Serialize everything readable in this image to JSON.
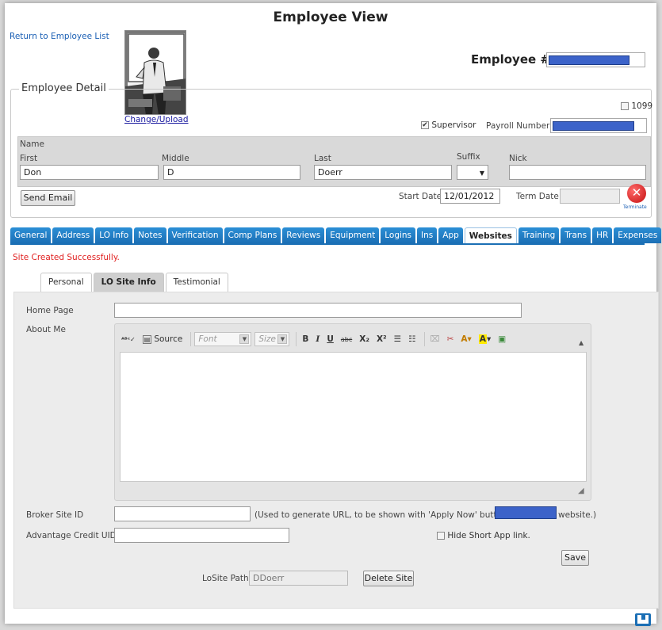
{
  "page_title": "Employee View",
  "return_link": "Return to Employee List",
  "photo": {
    "change_label": "Change/Upload"
  },
  "employee_number_label": "Employee #",
  "detail_legend": "Employee Detail",
  "flags": {
    "c1099": "1099",
    "supervisor": "Supervisor",
    "supervisor_checked": true
  },
  "payroll_label": "Payroll Number",
  "name": {
    "section_label": "Name",
    "first_label": "First",
    "first_value": "Don",
    "middle_label": "Middle",
    "middle_value": "D",
    "last_label": "Last",
    "last_value": "Doerr",
    "suffix_label": "Suffix",
    "suffix_value": "",
    "nick_label": "Nick",
    "nick_value": ""
  },
  "send_email_label": "Send Email",
  "start_date_label": "Start Date",
  "start_date_value": "12/01/2012",
  "term_date_label": "Term Date",
  "terminate_label": "Terminate",
  "tabs": [
    "General",
    "Address",
    "LO Info",
    "Notes",
    "Verification",
    "Comp Plans",
    "Reviews",
    "Equipment",
    "Logins",
    "Ins",
    "App",
    "Websites",
    "Training",
    "Trans",
    "HR",
    "Expenses"
  ],
  "active_tab": "Websites",
  "success_message": "Site Created Successfully.",
  "subtabs": [
    "Personal",
    "LO Site Info",
    "Testimonial"
  ],
  "active_subtab": "LO Site Info",
  "form": {
    "home_page_label": "Home Page",
    "about_me_label": "About Me",
    "broker_site_label": "Broker Site ID",
    "broker_note_pre": "(Used to generate URL, to be shown with 'Apply Now' button on",
    "broker_note_post": "website.)",
    "advantage_label": "Advantage Credit UID",
    "hide_short_app_label": "Hide Short App link.",
    "save_label": "Save",
    "losite_path_label": "LoSite Path:",
    "losite_path_value": "DDoerr",
    "delete_site_label": "Delete Site"
  },
  "editor_toolbar": {
    "source_label": "Source",
    "font_placeholder": "Font",
    "size_placeholder": "Size"
  },
  "colors": {
    "tab_blue": "#1b6fb5",
    "redaction_blue": "#3c63c9",
    "error_red": "#e02020"
  }
}
